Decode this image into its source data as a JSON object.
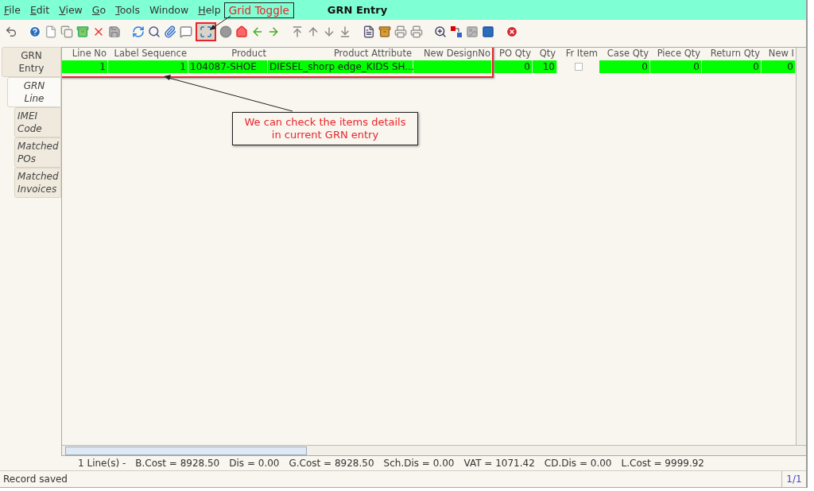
{
  "menu": [
    {
      "label": "File",
      "underlined": true
    },
    {
      "label": "Edit",
      "underlined": true
    },
    {
      "label": "View",
      "underlined": true
    },
    {
      "label": "Go",
      "underlined": true
    },
    {
      "label": "Tools",
      "underlined": true
    },
    {
      "label": "Window",
      "underlined": false
    },
    {
      "label": "Help",
      "underlined": true
    }
  ],
  "annotation_label": "Grid Toggle",
  "window": {
    "title": "GRN Entry"
  },
  "tabs": [
    {
      "label": "GRN Entry",
      "selected": false
    },
    {
      "label": "GRN Line",
      "selected": true,
      "children": [
        {
          "label": "IMEI Code",
          "selected": false
        },
        {
          "label": "Matched POs",
          "selected": false
        },
        {
          "label": "Matched Invoices",
          "selected": false
        }
      ]
    }
  ],
  "table": {
    "columns": [
      "Line No",
      "Label Sequence",
      "Product",
      "Product Attribute",
      "New DesignNo",
      "PO Qty",
      "Qty",
      "Fr Item",
      "Case Qty",
      "Piece Qty",
      "Return Qty",
      "New I"
    ],
    "rows": [
      {
        "cells": [
          {
            "kind": "number",
            "text": "1"
          },
          {
            "kind": "number",
            "text": "1"
          },
          {
            "kind": "text",
            "text": "104087-SHOE"
          },
          {
            "kind": "text",
            "text": "DIESEL_shorp edge_KIDS SH..."
          },
          {
            "kind": "text",
            "text": ""
          },
          {
            "kind": "number",
            "text": "0"
          },
          {
            "kind": "number",
            "text": "10"
          },
          {
            "kind": "checkbox",
            "checked": false
          },
          {
            "kind": "number",
            "text": "0"
          },
          {
            "kind": "number",
            "text": "0"
          },
          {
            "kind": "number",
            "text": "0"
          },
          {
            "kind": "number",
            "text": "0"
          }
        ]
      }
    ]
  },
  "callout": {
    "lines": [
      "We can check the items details",
      "in current GRN entry"
    ]
  },
  "summary": [
    "1 Line(s) -",
    "B.Cost = 8928.50",
    "Dis = 0.00",
    "G.Cost = 8928.50",
    "Sch.Dis = 0.00",
    "VAT = 1071.42",
    "CD.Dis = 0.00",
    "L.Cost = 9999.92"
  ],
  "status_bar": {
    "message": "Record saved",
    "page": "1/1"
  }
}
